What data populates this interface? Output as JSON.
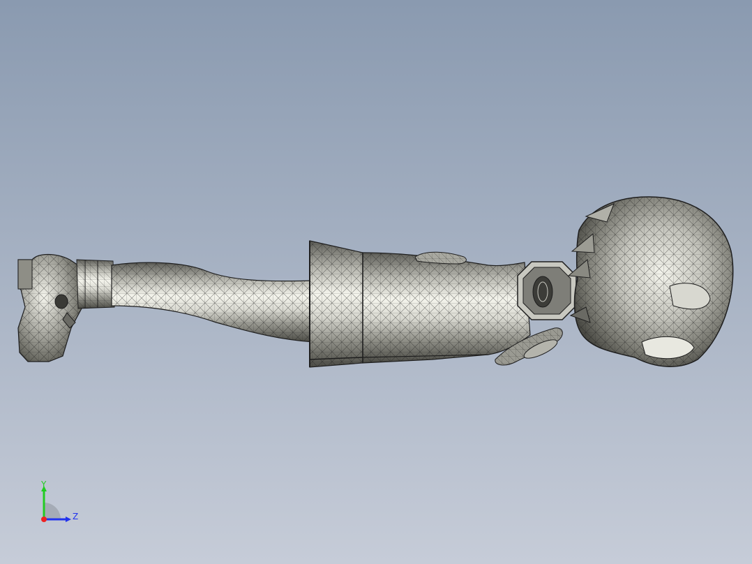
{
  "viewport": {
    "background_top": "#8a9ab0",
    "background_bottom": "#c6ccd8"
  },
  "model": {
    "shade_light": "#f4f4ec",
    "shade_mid": "#b8b8b0",
    "shade_dark": "#5e5e58",
    "edge_color": "#1e1e1e"
  },
  "triad": {
    "y_label": "Y",
    "z_label": "Z",
    "y_color": "#22cc22",
    "z_color": "#2233ee",
    "x_color": "#ee2222"
  }
}
